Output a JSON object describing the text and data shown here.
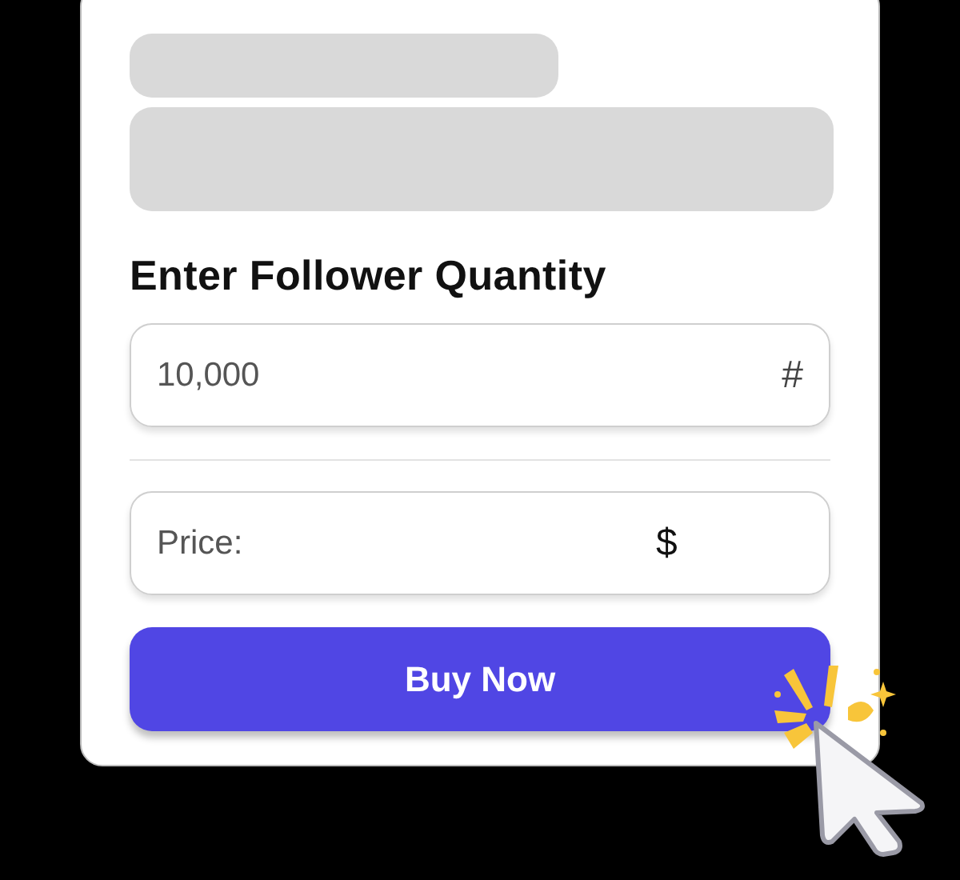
{
  "heading": "Enter Follower Quantity",
  "quantity_field": {
    "value": "10,000",
    "suffix": "#"
  },
  "price_field": {
    "label": "Price:",
    "currency": "$"
  },
  "buy_button": {
    "label": "Buy Now"
  }
}
